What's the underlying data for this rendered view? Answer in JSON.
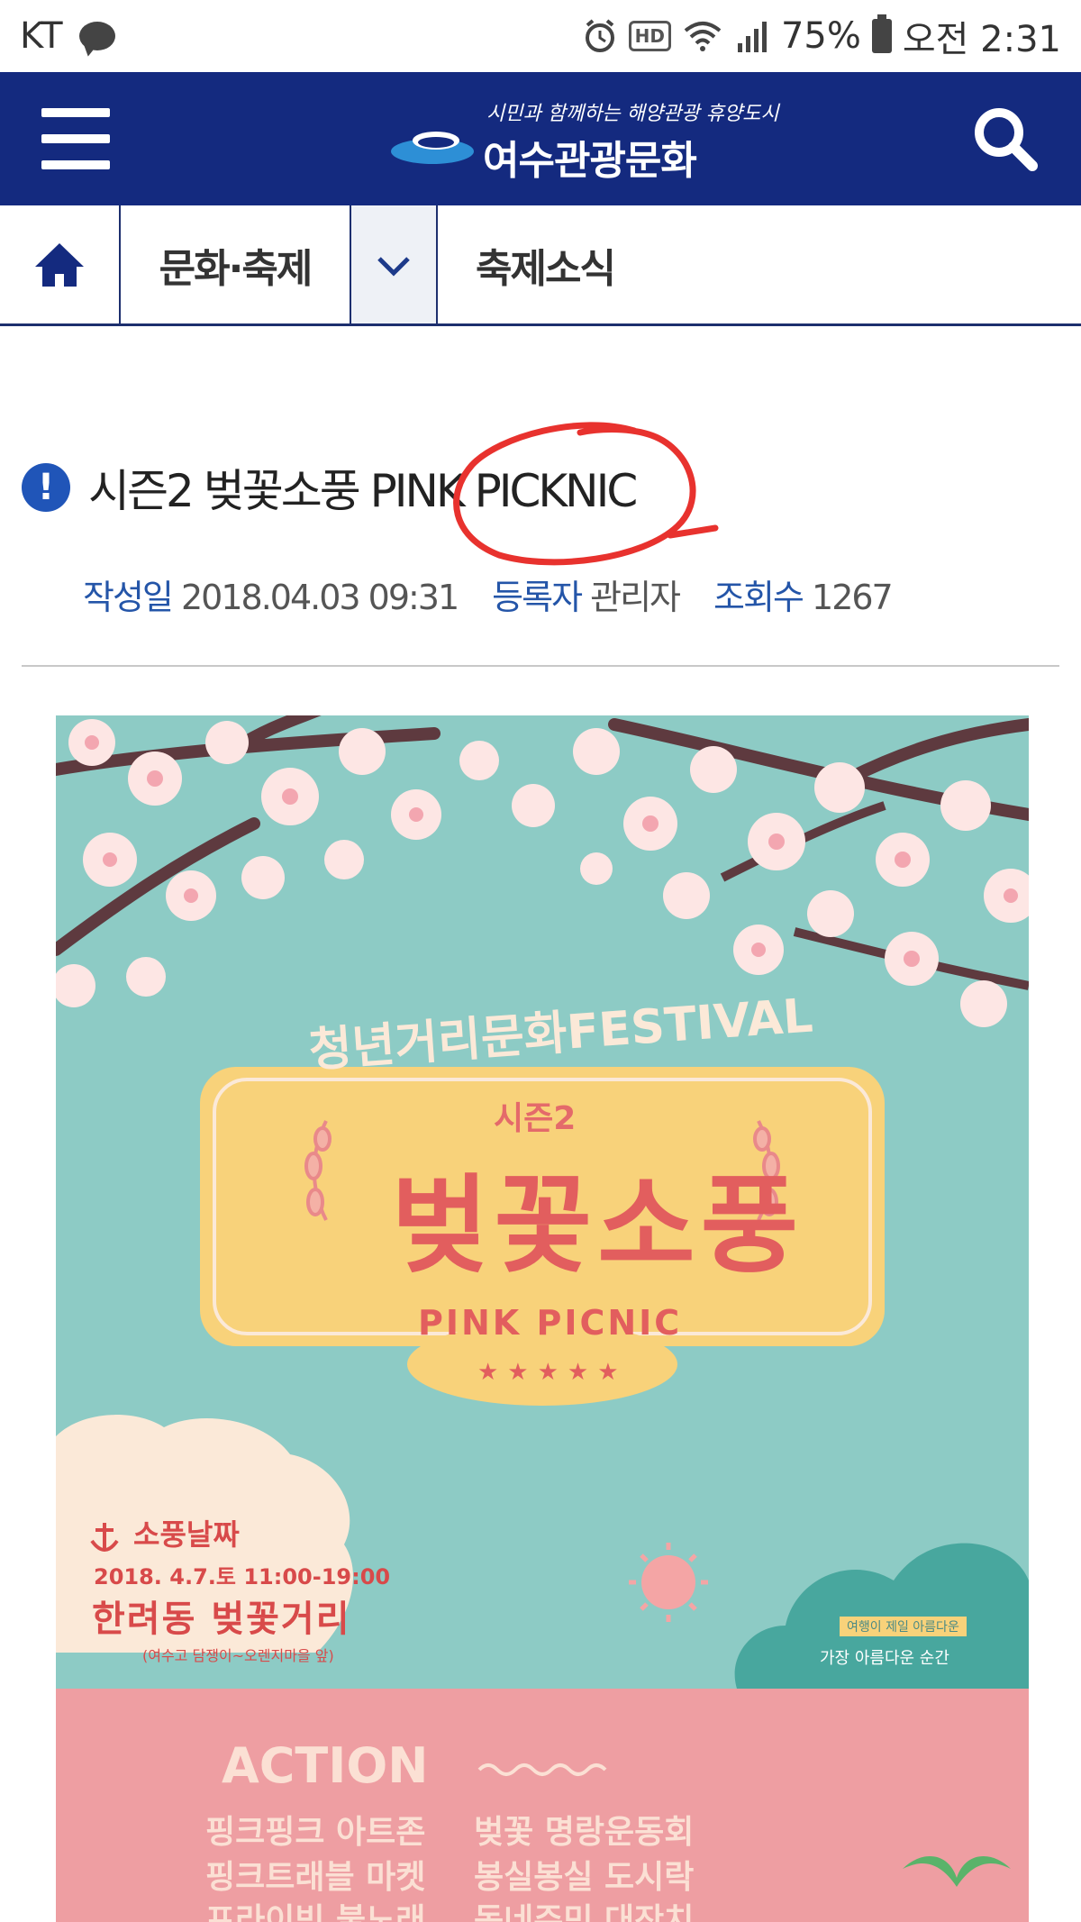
{
  "status_bar": {
    "carrier": "KT",
    "hd_label": "HD",
    "battery": "75%",
    "time": "오전 2:31"
  },
  "header": {
    "logo_tagline": "시민과 함께하는 해양관광 휴양도시",
    "logo_text": "여수관광문화",
    "background_color": "#142a7f"
  },
  "breadcrumb": {
    "category": "문화·축제",
    "current": "축제소식"
  },
  "post": {
    "title": "시즌2 벚꽃소풍 PINK PICKNIC",
    "meta": {
      "date_label": "작성일",
      "date_value": "2018.04.03 09:31",
      "author_label": "등록자",
      "author_value": "관리자",
      "views_label": "조회수",
      "views_value": "1267"
    }
  },
  "poster": {
    "festival": "청년거리문화FESTIVAL",
    "season": "시즌2",
    "main_title": "벚꽃소풍",
    "subtitle": "PINK PICNIC",
    "stars": "★★★★★",
    "when_label": "소풍날짜",
    "date_time": "2018. 4.7.토 11:00-19:00",
    "place": "한려동 벚꽃거리",
    "address": "(여수고 담쟁이~오렌지마을 앞)",
    "cloud_tag": "여행이 제일 아름다운",
    "cloud_text": "가장 아름다운 순간",
    "action_title": "ACTION",
    "actions_left": [
      "핑크핑크 아트존",
      "핑크트래블 마켓",
      "프라이빗 불노래"
    ],
    "actions_right": [
      "벚꽃 명랑운동회",
      "봉실봉실 도시락",
      "동네주민 대잔치"
    ]
  }
}
